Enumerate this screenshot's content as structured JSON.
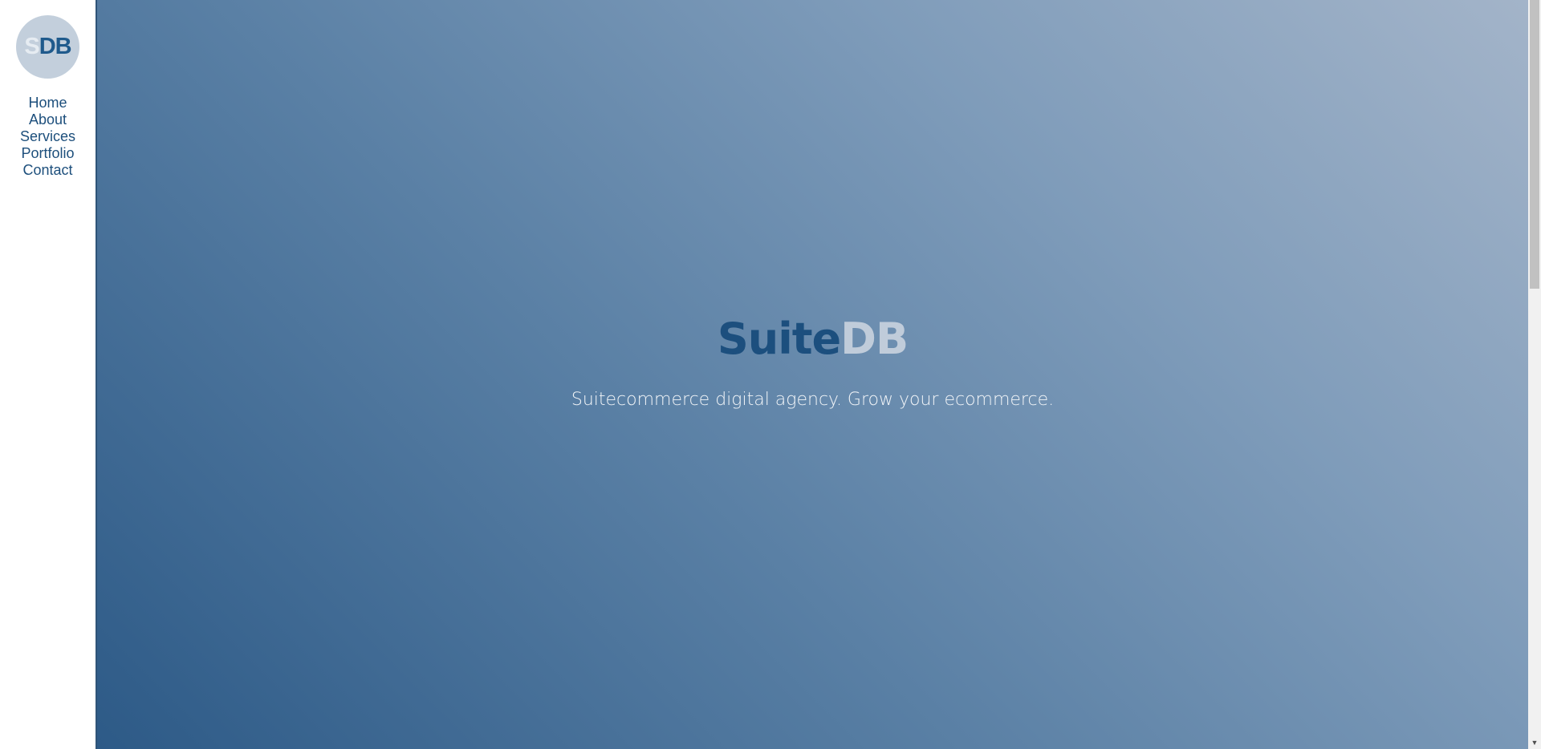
{
  "logo": {
    "s": "S",
    "db": "DB"
  },
  "nav": {
    "items": [
      {
        "label": "Home"
      },
      {
        "label": "About"
      },
      {
        "label": "Services"
      },
      {
        "label": "Portfolio"
      },
      {
        "label": "Contact"
      }
    ]
  },
  "hero": {
    "title_part1": "Suite",
    "title_part2": "DB",
    "subtitle": "Suitecommerce digital agency. Grow your ecommerce."
  },
  "scrollbar": {
    "down_arrow": "▼"
  },
  "colors": {
    "brand_dark": "#1c4f7e",
    "brand_light": "#c0ccda",
    "hero_gradient_start": "#2d5a87",
    "hero_gradient_end": "#a3b4c9"
  }
}
